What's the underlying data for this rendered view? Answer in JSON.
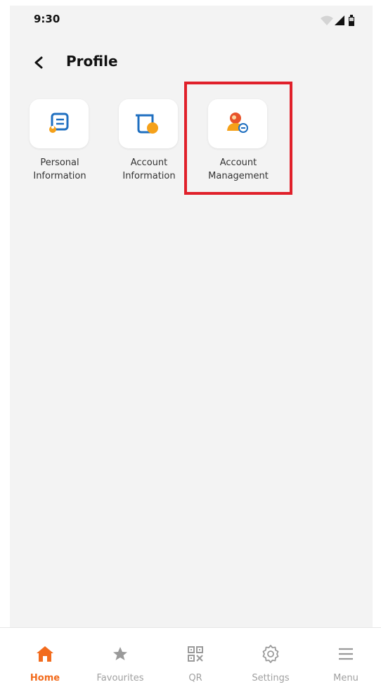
{
  "status_bar": {
    "time": "9:30"
  },
  "header": {
    "title": "Profile"
  },
  "tiles": [
    {
      "line1": "Personal",
      "line2": "Information",
      "icon": "personal-info-icon"
    },
    {
      "line1": "Account",
      "line2": "Information",
      "icon": "account-info-icon"
    },
    {
      "line1": "Account",
      "line2": "Management",
      "icon": "account-management-icon"
    }
  ],
  "bottom_nav": [
    {
      "label": "Home",
      "icon": "home-icon",
      "active": true
    },
    {
      "label": "Favourites",
      "icon": "star-icon"
    },
    {
      "label": "QR",
      "icon": "qr-code-icon"
    },
    {
      "label": "Settings",
      "icon": "gear-icon"
    },
    {
      "label": "Menu",
      "icon": "hamburger-menu-icon"
    }
  ],
  "colors": {
    "accent": "#f26b1d",
    "icon_blue": "#1f6fc0",
    "highlight": "#e0202a",
    "background": "#f3f3f3"
  }
}
